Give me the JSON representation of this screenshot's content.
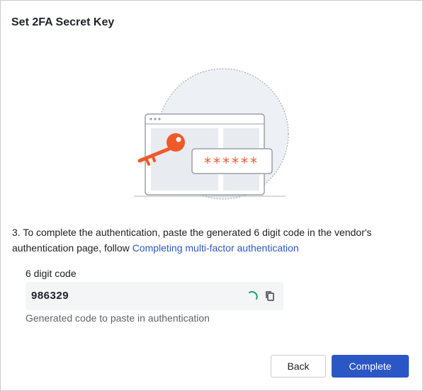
{
  "dialog": {
    "title": "Set 2FA Secret Key"
  },
  "illustration": {
    "masked_code": "******",
    "colors": {
      "accent": "#f05a2a",
      "circle": "#edf0f5",
      "window_border": "#9aa0a6",
      "panel": "#e8ebf0"
    }
  },
  "instructions": {
    "text": "3. To complete the authentication, paste the generated 6 digit code in the vendor's authentication page, follow ",
    "link_text": "Completing multi-factor authentication"
  },
  "code_field": {
    "label": "6 digit code",
    "value": "986329",
    "helper": "Generated code to paste in authentication",
    "icons": [
      "refresh-spinner-icon",
      "copy-icon"
    ]
  },
  "buttons": {
    "back": "Back",
    "complete": "Complete"
  },
  "colors": {
    "primary": "#2a56c6",
    "spinner": "#22a06b"
  }
}
